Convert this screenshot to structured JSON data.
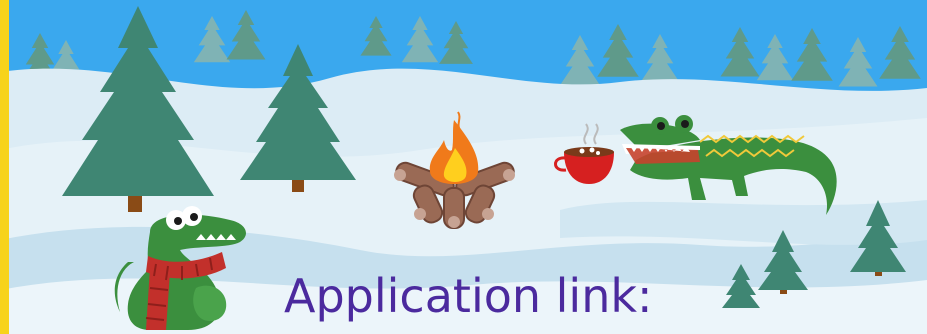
{
  "banner": {
    "heading": "Application link:"
  },
  "illustration": {
    "elements": [
      "pine-tree-icon",
      "campfire-icon",
      "hot-cocoa-mug-icon",
      "crocodile-icon",
      "crocodile-with-scarf-icon"
    ]
  },
  "colors": {
    "sky": "#3aa8ee",
    "snow": "#e4f1f8",
    "snow_shadow": "#c8e2ef",
    "tree": "#3f8673",
    "tree_far": "#6ea9a8",
    "trunk": "#8a4b16",
    "crocodile": "#3b8f3e",
    "scarf": "#c2302b",
    "flame_outer": "#f07a1a",
    "flame_inner": "#ffcf1e",
    "mug": "#d62020",
    "left_stripe": "#f7d31b",
    "heading_text": "#4b2a9e"
  }
}
